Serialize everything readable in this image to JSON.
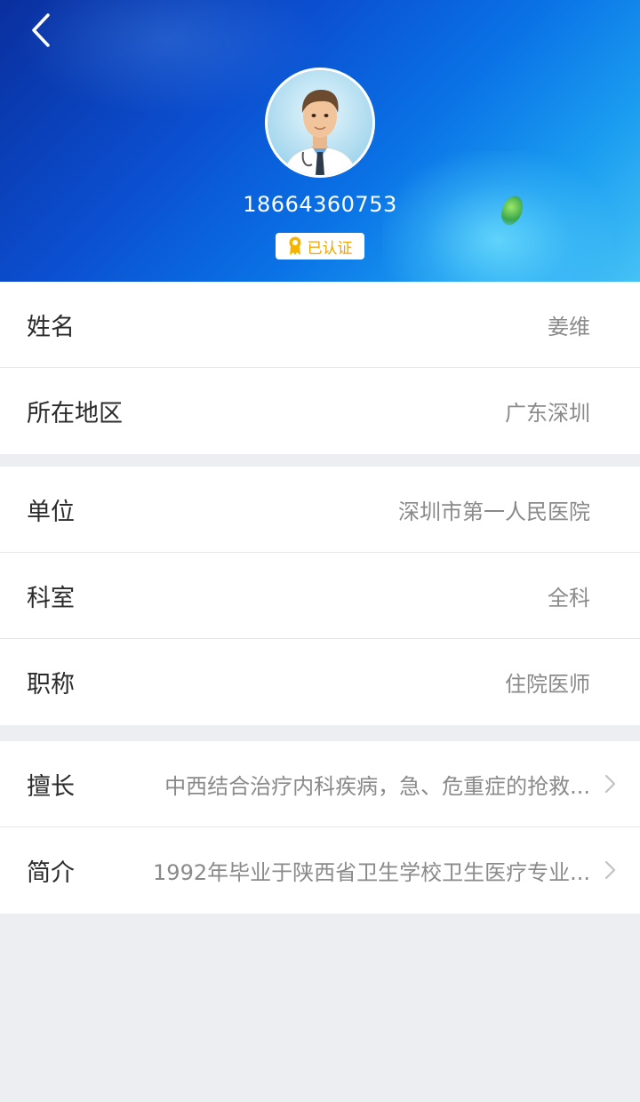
{
  "header": {
    "phone": "18664360753",
    "badge_label": "已认证",
    "colors": {
      "badge_text": "#f0a400",
      "badge_icon": "#f4b400"
    }
  },
  "groups": [
    {
      "rows": [
        {
          "label": "姓名",
          "value": "姜维"
        },
        {
          "label": "所在地区",
          "value": "广东深圳"
        }
      ]
    },
    {
      "rows": [
        {
          "label": "单位",
          "value": "深圳市第一人民医院"
        },
        {
          "label": "科室",
          "value": "全科"
        },
        {
          "label": "职称",
          "value": "住院医师"
        }
      ]
    },
    {
      "rows": [
        {
          "label": "擅长",
          "value": "中西结合治疗内科疾病，急、危重症的抢救..."
        },
        {
          "label": "简介",
          "value": "1992年毕业于陕西省卫生学校卫生医疗专业..."
        }
      ]
    }
  ],
  "icons": [
    "back-arrow-icon",
    "certified-ribbon-icon",
    "chevron-right-icon"
  ]
}
